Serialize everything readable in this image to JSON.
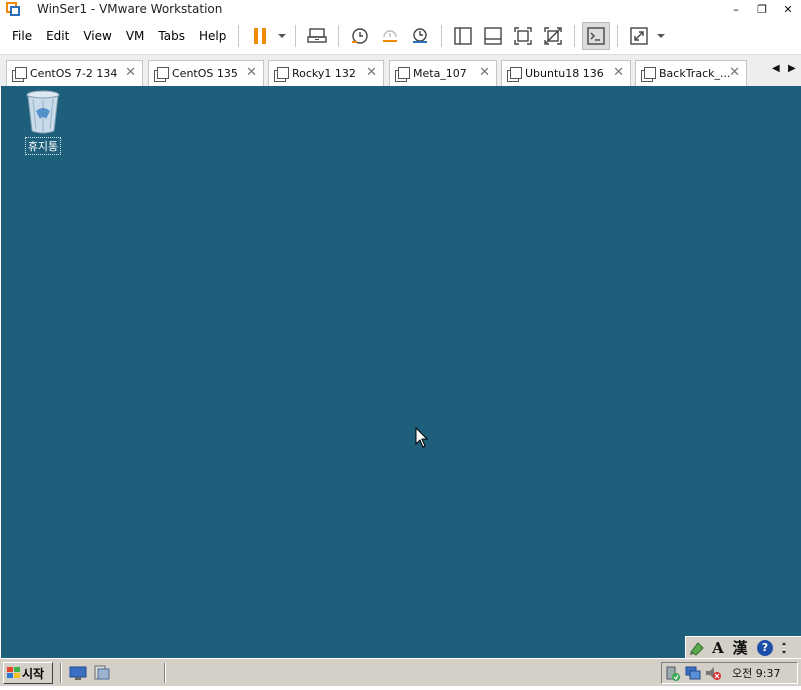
{
  "window": {
    "title": "WinSer1 - VMware Workstation",
    "controls": [
      "–",
      "❐",
      "✕"
    ]
  },
  "menu": [
    "File",
    "Edit",
    "View",
    "VM",
    "Tabs",
    "Help"
  ],
  "toolbar": {
    "icons": [
      "pause-icon",
      "send-ctrl-alt-del-icon",
      "snapshot-take-icon",
      "snapshot-revert-icon",
      "snapshot-manager-icon",
      "library-view-icon",
      "thumbnail-bar-icon",
      "full-screen-icon",
      "unity-icon",
      "console-view-icon",
      "stretch-guest-icon"
    ],
    "accent": "#f08a00"
  },
  "tabs": [
    {
      "label": "CentOS 7-2 134",
      "close": "✕"
    },
    {
      "label": "CentOS 135",
      "close": "✕"
    },
    {
      "label": "Rocky1 132",
      "close": "✕"
    },
    {
      "label": "Meta_107",
      "close": "✕"
    },
    {
      "label": "Ubuntu18 136",
      "close": "✕"
    },
    {
      "label": "BackTrack_...",
      "close": "✕"
    }
  ],
  "tab_nav": {
    "prev": "◀",
    "next": "▶"
  },
  "desktop": {
    "background": "#1e5f7b",
    "recycle_bin_label": "휴지통"
  },
  "langbar": {
    "input_a": "A",
    "hanja": "漢",
    "help": "?"
  },
  "taskbar": {
    "start_label": "시작",
    "clock": "오전 9:37"
  }
}
